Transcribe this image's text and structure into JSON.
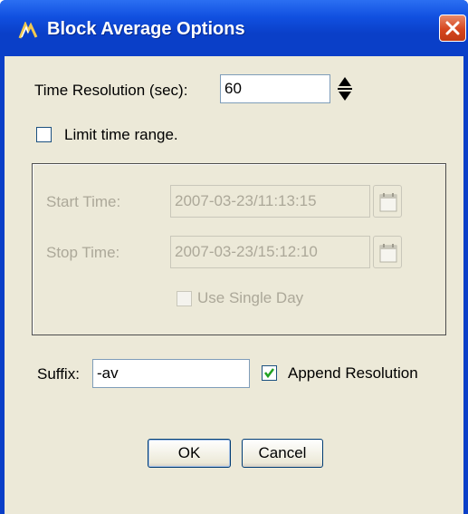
{
  "window": {
    "title": "Block Average Options",
    "title_icon": "app-logo-icon",
    "close_icon": "close-icon"
  },
  "time_resolution": {
    "label": "Time Resolution (sec):",
    "value": "60"
  },
  "limit_time_range": {
    "label": "Limit time range.",
    "checked": false
  },
  "time_range": {
    "start_label": "Start Time:",
    "start_value": "2007-03-23/11:13:15",
    "stop_label": "Stop Time:",
    "stop_value": "2007-03-23/15:12:10",
    "single_day_label": "Use Single Day",
    "single_day_checked": false,
    "enabled": false
  },
  "suffix": {
    "label": "Suffix:",
    "value": "-av"
  },
  "append_resolution": {
    "label": "Append Resolution",
    "checked": true
  },
  "buttons": {
    "ok": "OK",
    "cancel": "Cancel"
  },
  "colors": {
    "titlebar": "#0a3fc8",
    "dialog_bg": "#ece9d8",
    "close_button": "#d6461f",
    "disabled_text": "#aca899"
  }
}
